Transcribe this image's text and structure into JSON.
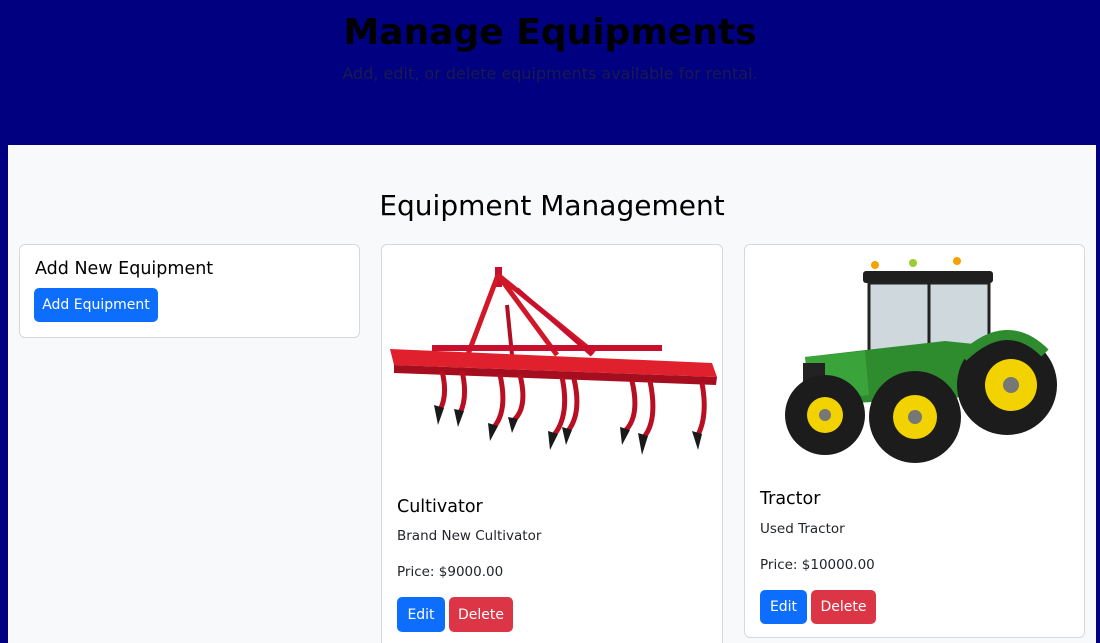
{
  "header": {
    "title": "Manage Equipments",
    "subtitle": "Add, edit, or delete equipments available for rental."
  },
  "main": {
    "heading": "Equipment Management"
  },
  "add_card": {
    "title": "Add New Equipment",
    "button_label": "Add Equipment"
  },
  "equipment": [
    {
      "name": "Cultivator",
      "description": "Brand New Cultivator",
      "price": "Price: $9000.00",
      "image_icon": "cultivator-image",
      "edit_label": "Edit",
      "delete_label": "Delete"
    },
    {
      "name": "Tractor",
      "description": "Used Tractor",
      "price": "Price: $10000.00",
      "image_icon": "tractor-image",
      "edit_label": "Edit",
      "delete_label": "Delete"
    }
  ],
  "colors": {
    "header_bg": "#000080",
    "primary": "#0d6efd",
    "danger": "#dc3545",
    "content_bg": "#f8f9fa"
  }
}
